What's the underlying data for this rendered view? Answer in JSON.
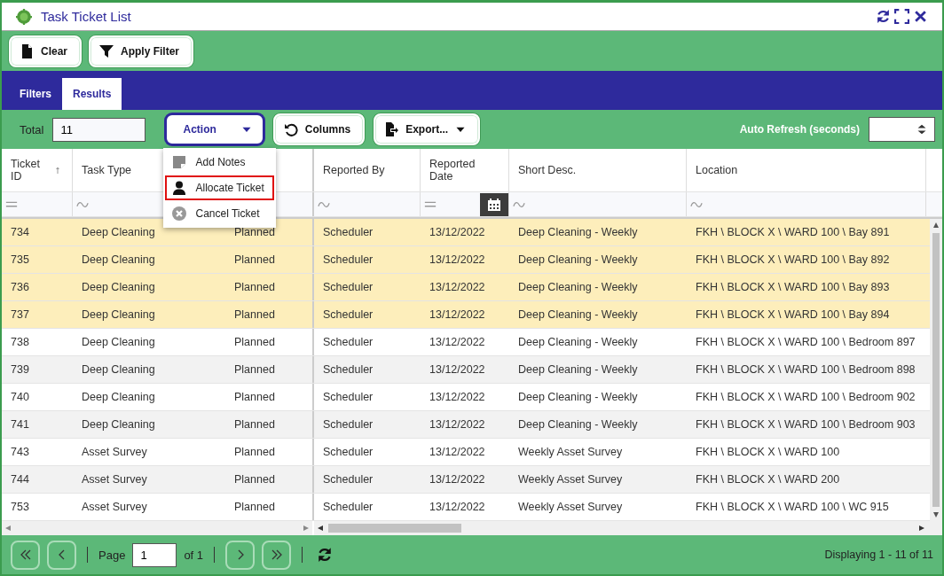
{
  "window": {
    "title": "Task Ticket List"
  },
  "toolbar": {
    "buttons": [
      {
        "label": "Clear"
      },
      {
        "label": "Apply Filter"
      }
    ]
  },
  "tabs": [
    {
      "label": "Filters",
      "selected": false
    },
    {
      "label": "Results",
      "selected": true
    }
  ],
  "action_bar": {
    "total_label": "Total",
    "total_value": "11",
    "buttons": [
      {
        "label": "Action",
        "kind": "dropdown",
        "selected": true
      },
      {
        "label": "Columns",
        "kind": "button",
        "selected": false
      },
      {
        "label": "Export...",
        "kind": "dropdown",
        "selected": false
      }
    ],
    "auto_refresh_label": "Auto Refresh (seconds)"
  },
  "action_menu": {
    "items": [
      {
        "label": "Add Notes",
        "highlighted": false
      },
      {
        "label": "Allocate Ticket",
        "highlighted": true
      },
      {
        "label": "Cancel Ticket",
        "highlighted": false
      }
    ]
  },
  "table": {
    "columns": [
      {
        "label": "Ticket ID",
        "sorted": true,
        "kind": "number"
      },
      {
        "label": "Task Type",
        "sorted": false,
        "kind": "text"
      },
      {},
      {
        "label": "Reported By",
        "sorted": false,
        "kind": "text"
      },
      {
        "label": "Reported Date",
        "sorted": false,
        "kind": "date"
      },
      {
        "label": "Short Desc.",
        "sorted": false,
        "kind": "text"
      },
      {
        "label": "Location",
        "sorted": false,
        "kind": "text"
      }
    ],
    "rows": [
      {
        "selected": true,
        "cells": [
          "734",
          "Deep Cleaning",
          "Planned",
          "Scheduler",
          "13/12/2022",
          "Deep Cleaning - Weekly",
          "FKH \\ BLOCK X \\ WARD 100 \\ Bay 891"
        ]
      },
      {
        "selected": true,
        "cells": [
          "735",
          "Deep Cleaning",
          "Planned",
          "Scheduler",
          "13/12/2022",
          "Deep Cleaning - Weekly",
          "FKH \\ BLOCK X \\ WARD 100 \\ Bay 892"
        ]
      },
      {
        "selected": true,
        "cells": [
          "736",
          "Deep Cleaning",
          "Planned",
          "Scheduler",
          "13/12/2022",
          "Deep Cleaning - Weekly",
          "FKH \\ BLOCK X \\ WARD 100 \\ Bay 893"
        ]
      },
      {
        "selected": true,
        "cells": [
          "737",
          "Deep Cleaning",
          "Planned",
          "Scheduler",
          "13/12/2022",
          "Deep Cleaning - Weekly",
          "FKH \\ BLOCK X \\ WARD 100 \\ Bay 894"
        ]
      },
      {
        "selected": false,
        "cells": [
          "738",
          "Deep Cleaning",
          "Planned",
          "Scheduler",
          "13/12/2022",
          "Deep Cleaning - Weekly",
          "FKH \\ BLOCK X \\ WARD 100 \\ Bedroom 897"
        ]
      },
      {
        "selected": false,
        "cells": [
          "739",
          "Deep Cleaning",
          "Planned",
          "Scheduler",
          "13/12/2022",
          "Deep Cleaning - Weekly",
          "FKH \\ BLOCK X \\ WARD 100 \\ Bedroom 898"
        ]
      },
      {
        "selected": false,
        "cells": [
          "740",
          "Deep Cleaning",
          "Planned",
          "Scheduler",
          "13/12/2022",
          "Deep Cleaning - Weekly",
          "FKH \\ BLOCK X \\ WARD 100 \\ Bedroom 902"
        ]
      },
      {
        "selected": false,
        "cells": [
          "741",
          "Deep Cleaning",
          "Planned",
          "Scheduler",
          "13/12/2022",
          "Deep Cleaning - Weekly",
          "FKH \\ BLOCK X \\ WARD 100 \\ Bedroom 903"
        ]
      },
      {
        "selected": false,
        "cells": [
          "743",
          "Asset Survey",
          "Planned",
          "Scheduler",
          "13/12/2022",
          "Weekly Asset Survey",
          "FKH \\ BLOCK X \\ WARD 100"
        ]
      },
      {
        "selected": false,
        "cells": [
          "744",
          "Asset Survey",
          "Planned",
          "Scheduler",
          "13/12/2022",
          "Weekly Asset Survey",
          "FKH \\ BLOCK X \\ WARD 200"
        ]
      },
      {
        "selected": false,
        "cells": [
          "753",
          "Asset Survey",
          "Planned",
          "Scheduler",
          "13/12/2022",
          "Weekly Asset Survey",
          "FKH \\ BLOCK X \\ WARD 100 \\ WC 915"
        ]
      }
    ]
  },
  "pager": {
    "page_label": "Page",
    "page_value": "1",
    "of_label": "of 1",
    "status": "Displaying 1 - 11 of 11"
  }
}
